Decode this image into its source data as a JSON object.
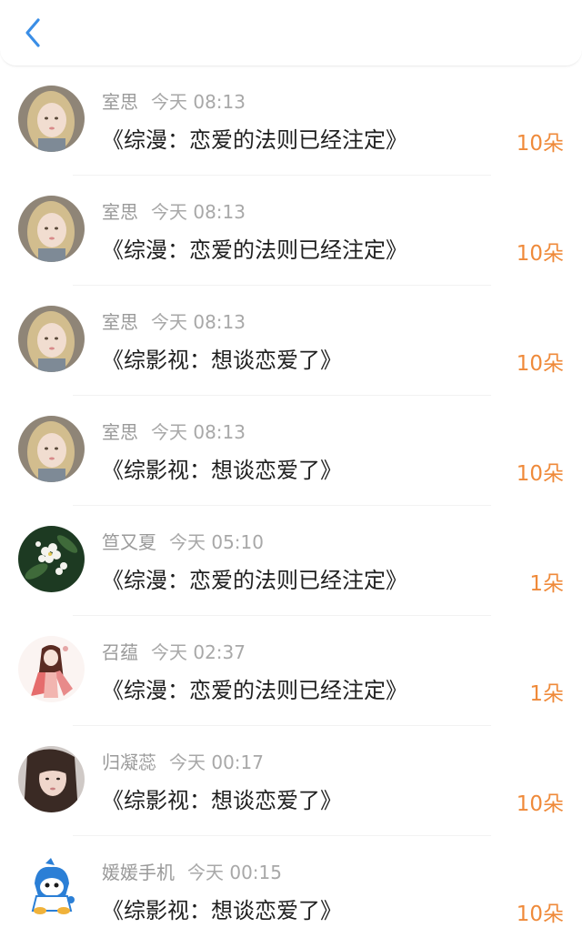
{
  "header": {
    "back_icon": "chevron-left-icon",
    "accent_color": "#3a8ee6"
  },
  "items": [
    {
      "user": "室思",
      "time": "今天 08:13",
      "title": "《综漫：恋爱的法则已经注定》",
      "amount": "10朵",
      "avatar_icon": "girl-portrait-avatar"
    },
    {
      "user": "室思",
      "time": "今天 08:13",
      "title": "《综漫：恋爱的法则已经注定》",
      "amount": "10朵",
      "avatar_icon": "girl-portrait-avatar"
    },
    {
      "user": "室思",
      "time": "今天 08:13",
      "title": "《综影视：想谈恋爱了》",
      "amount": "10朵",
      "avatar_icon": "girl-portrait-avatar"
    },
    {
      "user": "室思",
      "time": "今天 08:13",
      "title": "《综影视：想谈恋爱了》",
      "amount": "10朵",
      "avatar_icon": "girl-portrait-avatar"
    },
    {
      "user": "笪又夏",
      "time": "今天 05:10",
      "title": "《综漫：恋爱的法则已经注定》",
      "amount": "1朵",
      "avatar_icon": "white-flowers-avatar"
    },
    {
      "user": "召蕴",
      "time": "今天 02:37",
      "title": "《综漫：恋爱的法则已经注定》",
      "amount": "1朵",
      "avatar_icon": "anime-girl-avatar"
    },
    {
      "user": "归凝蕊",
      "time": "今天 00:17",
      "title": "《综影视：想谈恋爱了》",
      "amount": "10朵",
      "avatar_icon": "photo-girl-avatar"
    },
    {
      "user": "媛媛手机",
      "time": "今天 00:15",
      "title": "《综影视：想谈恋爱了》",
      "amount": "10朵",
      "avatar_icon": "cartoon-mascot-avatar"
    }
  ],
  "colors": {
    "amount": "#ef8a3a",
    "meta": "#9a9a9a",
    "title": "#1f1f1f"
  }
}
